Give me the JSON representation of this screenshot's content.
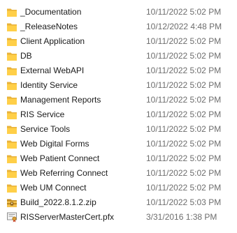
{
  "colors": {
    "folder_fill": "#FFCF48",
    "folder_tab": "#E8B23A",
    "zip_fill": "#F2C14E",
    "zip_dark": "#C08A1E",
    "cert_body": "#F4F4F4",
    "date_text": "#6D6D6D"
  },
  "files": [
    {
      "name": "_Documentation",
      "modified": "10/11/2022 5:02 PM",
      "icon": "folder-icon"
    },
    {
      "name": "_ReleaseNotes",
      "modified": "10/12/2022 4:48 PM",
      "icon": "folder-icon"
    },
    {
      "name": "Client Application",
      "modified": "10/11/2022 5:02 PM",
      "icon": "folder-icon"
    },
    {
      "name": "DB",
      "modified": "10/11/2022 5:02 PM",
      "icon": "folder-icon"
    },
    {
      "name": "External WebAPI",
      "modified": "10/11/2022 5:02 PM",
      "icon": "folder-icon"
    },
    {
      "name": "Identity Service",
      "modified": "10/11/2022 5:02 PM",
      "icon": "folder-icon"
    },
    {
      "name": "Management Reports",
      "modified": "10/11/2022 5:02 PM",
      "icon": "folder-icon"
    },
    {
      "name": "RIS Service",
      "modified": "10/11/2022 5:02 PM",
      "icon": "folder-icon"
    },
    {
      "name": "Service Tools",
      "modified": "10/11/2022 5:02 PM",
      "icon": "folder-icon"
    },
    {
      "name": "Web Digital Forms",
      "modified": "10/11/2022 5:02 PM",
      "icon": "folder-icon"
    },
    {
      "name": "Web Patient Connect",
      "modified": "10/11/2022 5:02 PM",
      "icon": "folder-icon"
    },
    {
      "name": "Web Referring Connect",
      "modified": "10/11/2022 5:02 PM",
      "icon": "folder-icon"
    },
    {
      "name": "Web UM Connect",
      "modified": "10/11/2022 5:02 PM",
      "icon": "folder-icon"
    },
    {
      "name": "Build_2022.8.1.2.zip",
      "modified": "10/11/2022 5:03 PM",
      "icon": "zip-archive-icon"
    },
    {
      "name": "RISServerMasterCert.pfx",
      "modified": "3/31/2016 1:38 PM",
      "icon": "certificate-icon"
    }
  ]
}
